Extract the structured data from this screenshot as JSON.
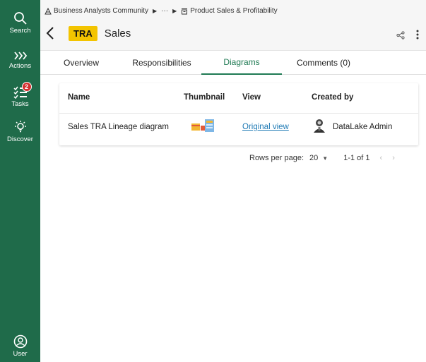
{
  "sidebar": {
    "items": [
      {
        "label": "Search",
        "icon": "search-icon"
      },
      {
        "label": "Actions",
        "icon": "chevrons-right-icon"
      },
      {
        "label": "Tasks",
        "icon": "task-list-icon",
        "badge": "2"
      },
      {
        "label": "Discover",
        "icon": "lightbulb-icon"
      }
    ],
    "user": {
      "label": "User",
      "icon": "user-circle-icon"
    }
  },
  "breadcrumb": {
    "community": "Business Analysts Community",
    "ellipsis": "···",
    "domain": "Product Sales & Profitability"
  },
  "header": {
    "type_badge": "TRA",
    "title": "Sales"
  },
  "tabs": [
    {
      "label": "Overview"
    },
    {
      "label": "Responsibilities"
    },
    {
      "label": "Diagrams",
      "active": true
    },
    {
      "label": "Comments (0)"
    }
  ],
  "table": {
    "headers": {
      "name": "Name",
      "thumbnail": "Thumbnail",
      "view": "View",
      "created_by": "Created by"
    },
    "rows": [
      {
        "name": "Sales TRA Lineage diagram",
        "view": "Original view",
        "created_by": "DataLake Admin"
      }
    ]
  },
  "pagination": {
    "rows_label": "Rows per page:",
    "rows_value": "20",
    "range": "1-1 of 1",
    "prev": "‹",
    "next": "›"
  },
  "colors": {
    "sidebar": "#1f6b4a",
    "accent": "#1f7a53",
    "badge": "#f3c400",
    "link": "#1f7ab5",
    "notification": "#d32f2f"
  }
}
